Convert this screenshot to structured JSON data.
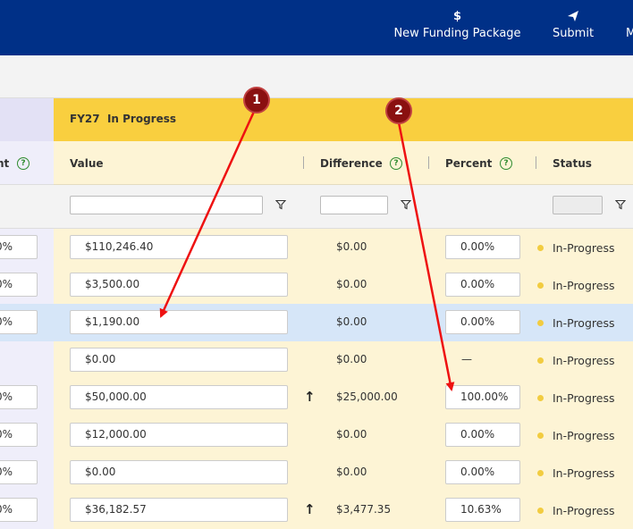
{
  "toolbar": {
    "new_funding": {
      "glyph": "$",
      "label": "New Funding Package"
    },
    "submit": {
      "glyph": "➤",
      "label": "Submit"
    },
    "more": {
      "glyph": "",
      "label": "M"
    }
  },
  "fiscal_year": {
    "label": "FY27  In Progress"
  },
  "columns": {
    "left_cut": "nt",
    "value": "Value",
    "difference": "Difference",
    "percent": "Percent",
    "status": "Status"
  },
  "annotations": [
    "1",
    "2"
  ],
  "rows": [
    {
      "left_pct": "0%",
      "value": "$110,246.40",
      "difference": "$0.00",
      "percent": "0.00%",
      "status": "In-Progress"
    },
    {
      "left_pct": "0%",
      "value": "$3,500.00",
      "difference": "$0.00",
      "percent": "0.00%",
      "status": "In-Progress"
    },
    {
      "left_pct": "0%",
      "value": "$1,190.00",
      "difference": "$0.00",
      "percent": "0.00%",
      "status": "In-Progress"
    },
    {
      "left_pct": "",
      "value": "$0.00",
      "difference": "$0.00",
      "percent": "—",
      "status": "In-Progress"
    },
    {
      "left_pct": "0%",
      "value": "$50,000.00",
      "difference": "$25,000.00",
      "percent": "100.00%",
      "status": "In-Progress"
    },
    {
      "left_pct": "0%",
      "value": "$12,000.00",
      "difference": "$0.00",
      "percent": "0.00%",
      "status": "In-Progress"
    },
    {
      "left_pct": "0%",
      "value": "$0.00",
      "difference": "$0.00",
      "percent": "0.00%",
      "status": "In-Progress"
    },
    {
      "left_pct": "0%",
      "value": "$36,182.57",
      "difference": "$3,477.35",
      "percent": "10.63%",
      "status": "In-Progress"
    }
  ]
}
